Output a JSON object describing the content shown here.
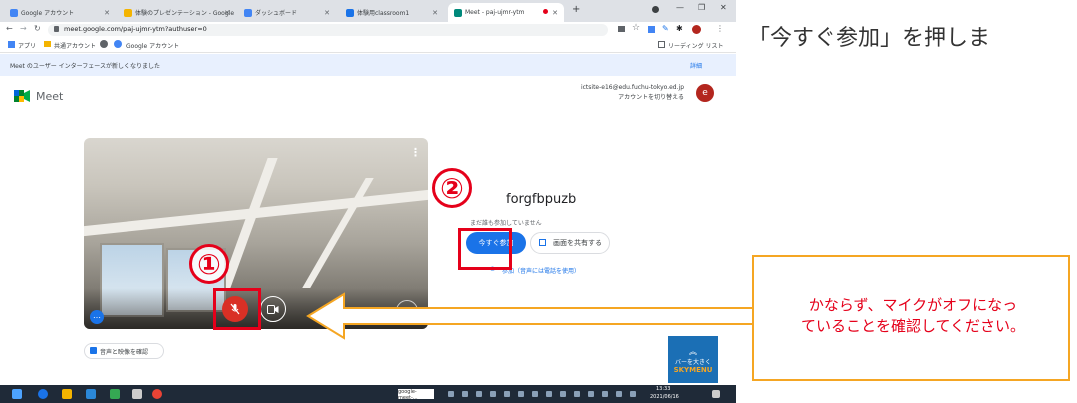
{
  "browser": {
    "tabs": [
      {
        "label": "Google アカウント",
        "favicon_color": "#4285f4"
      },
      {
        "label": "体験のプレゼンテーション - Google",
        "favicon_color": "#f4b400"
      },
      {
        "label": "ダッシュボード",
        "favicon_color": "#4285f4"
      },
      {
        "label": "体験用classroom1",
        "favicon_color": "#1a73e8"
      },
      {
        "label": "Meet - paj-ujmr-ytm",
        "favicon_color": "#00897b"
      }
    ],
    "new_tab": "+",
    "url": "meet.google.com/paj-ujmr-ytm?authuser=0",
    "bookmarks": [
      "アプリ",
      "共通アカウント",
      "Google アカウント"
    ],
    "reading_list": "リーディング リスト"
  },
  "meet": {
    "notice_text": "Meet のユーザー インターフェースが新しくなりました",
    "notice_link": "詳細",
    "logo_text": "Meet",
    "account_email": "ictsite-e16@edu.fuchu-tokyo.ed.jp",
    "account_switch": "アカウントを切り替える",
    "avatar_letter": "e",
    "meeting_code": "forgfbpuzb",
    "status_text": "まだ誰も参加していません",
    "join_button": "今すぐ参加",
    "present_button": "画面を共有する",
    "audio_link": "参加（音声には電話を使用）",
    "check_av": "音声と映像を確認"
  },
  "skymenu": {
    "line1": "バーを大きく",
    "line2": "SKYMENU"
  },
  "taskbar": {
    "search": "google-meet-...",
    "time": "13:33",
    "date": "2021/06/16"
  },
  "annotations": {
    "instruction": "「今すぐ参加」を押しま",
    "step1": "①",
    "step2": "②",
    "callout": [
      "かならず、マイクがオフになっ",
      "ていることを確認してください。"
    ]
  },
  "colors": {
    "accent_red": "#e5001a",
    "join_blue": "#1a73e8",
    "callout_border": "#f5a623",
    "callout_text": "#e5001a"
  }
}
